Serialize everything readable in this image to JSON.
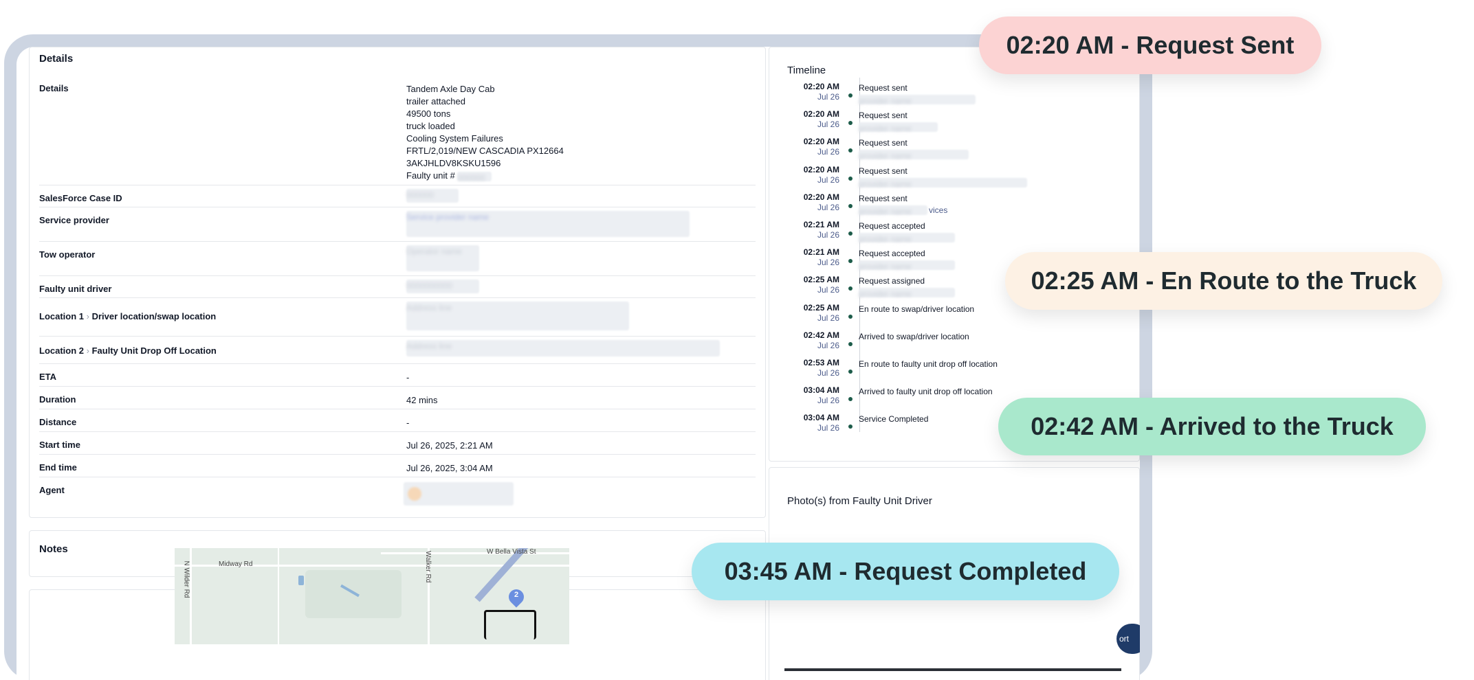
{
  "details": {
    "header": "Details",
    "rows": [
      {
        "label": "Details",
        "lines": [
          "Tandem Axle Day Cab",
          "trailer attached",
          "49500 tons",
          "truck loaded",
          "Cooling System Failures",
          "FRTL/2,019/NEW CASCADIA PX12664",
          "3AKJHLDV8KSKU1596",
          "Faulty unit #"
        ]
      },
      {
        "label": "SalesForce Case ID"
      },
      {
        "label": "Service provider"
      },
      {
        "label": "Tow operator"
      },
      {
        "label": "Faulty unit driver"
      },
      {
        "label": "Location 1",
        "sublabel": "Driver location/swap location"
      },
      {
        "label": "Location 2",
        "sublabel": "Faulty Unit Drop Off Location"
      },
      {
        "label": "ETA",
        "value": "-"
      },
      {
        "label": "Duration",
        "value": "42 mins"
      },
      {
        "label": "Distance",
        "value": "-"
      },
      {
        "label": "Start time",
        "value": "Jul 26, 2025, 2:21 AM"
      },
      {
        "label": "End time",
        "value": "Jul 26, 2025, 3:04 AM"
      },
      {
        "label": "Agent"
      }
    ]
  },
  "notes": {
    "title": "Notes"
  },
  "map": {
    "streets": [
      "Midway Rd",
      "N Wilder Rd",
      "Walker Rd",
      "W Bella Vista St"
    ],
    "marker_label": "2"
  },
  "timeline": {
    "title": "Timeline",
    "events": [
      {
        "time": "02:20 AM",
        "date": "Jul 26",
        "label": "Request sent"
      },
      {
        "time": "02:20 AM",
        "date": "Jul 26",
        "label": "Request sent"
      },
      {
        "time": "02:20 AM",
        "date": "Jul 26",
        "label": "Request sent"
      },
      {
        "time": "02:20 AM",
        "date": "Jul 26",
        "label": "Request sent"
      },
      {
        "time": "02:20 AM",
        "date": "Jul 26",
        "label": "Request sent",
        "extra": "vices"
      },
      {
        "time": "02:21 AM",
        "date": "Jul 26",
        "label": "Request accepted"
      },
      {
        "time": "02:21 AM",
        "date": "Jul 26",
        "label": "Request accepted"
      },
      {
        "time": "02:25 AM",
        "date": "Jul 26",
        "label": "Request assigned"
      },
      {
        "time": "02:25 AM",
        "date": "Jul 26",
        "label": "En route to swap/driver location"
      },
      {
        "time": "02:42 AM",
        "date": "Jul 26",
        "label": "Arrived to swap/driver location"
      },
      {
        "time": "02:53 AM",
        "date": "Jul 26",
        "label": "En route to faulty unit drop off location"
      },
      {
        "time": "03:04 AM",
        "date": "Jul 26",
        "label": "Arrived to faulty unit drop off location"
      },
      {
        "time": "03:04 AM",
        "date": "Jul 26",
        "label": "Service Completed"
      }
    ]
  },
  "photos": {
    "title": "Photo(s) from Faulty Unit Driver",
    "button_fragment": "ort"
  },
  "callouts": [
    {
      "text": "02:20 AM - Request Sent",
      "color": "#fcd3d3"
    },
    {
      "text": "02:25 AM - En Route to the Truck",
      "color": "#fdf1e4"
    },
    {
      "text": "02:42 AM - Arrived to the Truck",
      "color": "#a9e8cc"
    },
    {
      "text": "03:45 AM - Request Completed",
      "color": "#a7e7f0"
    }
  ]
}
